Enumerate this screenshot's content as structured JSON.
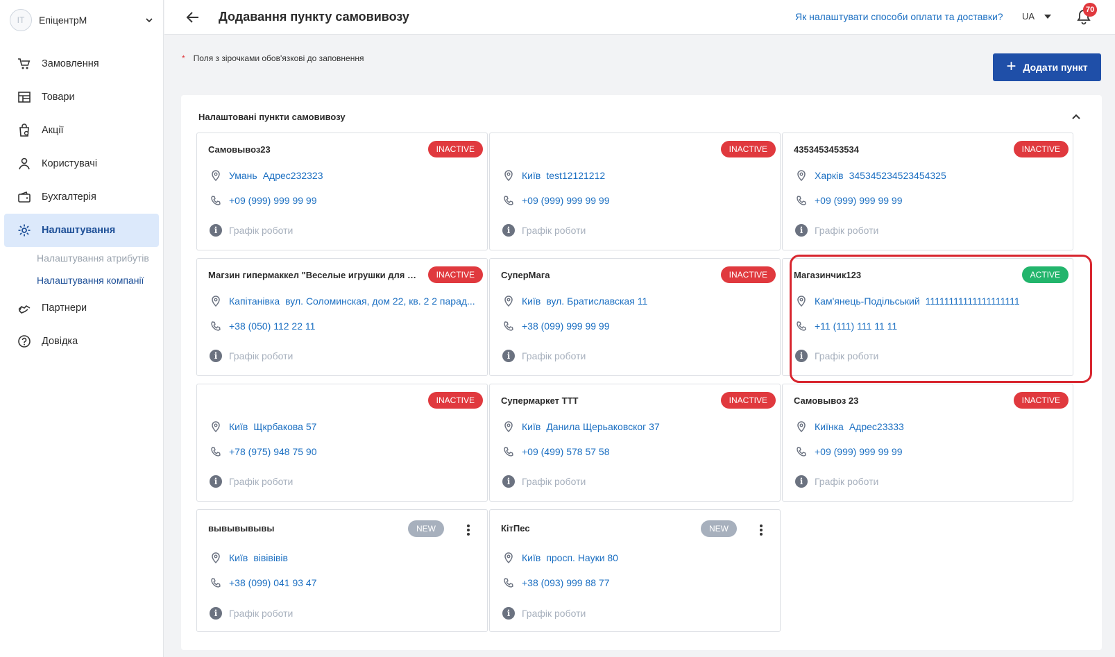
{
  "sidebar": {
    "avatar_initials": "IT",
    "company_name": "ЕпіцентрМ",
    "items": [
      {
        "label": "Замовлення",
        "icon": "cart-icon"
      },
      {
        "label": "Товари",
        "icon": "store-icon"
      },
      {
        "label": "Акції",
        "icon": "shopping-bag-icon"
      },
      {
        "label": "Користувачі",
        "icon": "user-icon"
      },
      {
        "label": "Бухгалтерія",
        "icon": "wallet-icon"
      },
      {
        "label": "Налаштування",
        "icon": "gear-icon",
        "active": true
      },
      {
        "label": "Партнери",
        "icon": "handshake-icon"
      },
      {
        "label": "Довідка",
        "icon": "question-circle-icon"
      }
    ],
    "sub_items": [
      {
        "label": "Налаштування атрибутів"
      },
      {
        "label": "Налаштування компанії",
        "active": true
      }
    ]
  },
  "header": {
    "title": "Додавання пункту самовивозу",
    "help_link": "Як налаштувати способи оплати та доставки?",
    "language": "UA",
    "notifications_count": "70"
  },
  "main": {
    "required_note": "Поля з зірочками обов'язкові до заповнення",
    "required_star": "*",
    "add_button": "Додати пункт",
    "panel_title": "Налаштовані пункти самовивозу",
    "schedule_label": "Графік роботи",
    "cards": [
      {
        "title": "Самовывоз23",
        "status": "INACTIVE",
        "city": "Умань",
        "address": "Адрес232323",
        "phone": "+09 (999) 999 99 99"
      },
      {
        "title": "",
        "status": "INACTIVE",
        "city": "Київ",
        "address": "test12121212",
        "phone": "+09 (999) 999 99 99"
      },
      {
        "title": "4353453453534",
        "status": "INACTIVE",
        "city": "Харків",
        "address": "345345234523454325",
        "phone": "+09 (999) 999 99 99"
      },
      {
        "title": "Магзин гипермаккел \"Веселые игрушки для ва...",
        "status": "INACTIVE",
        "city": "Капітанівка",
        "address": "вул. Соломинская, дом 22, кв. 2 2 парад...",
        "phone": "+38 (050) 112 22 11"
      },
      {
        "title": "СуперМага",
        "status": "INACTIVE",
        "city": "Київ",
        "address": "вул. Братиславская 11",
        "phone": "+38 (099) 999 99 99"
      },
      {
        "title": "Магазинчик123",
        "status": "ACTIVE",
        "city": "Кам'янець-Подільський",
        "address": "11111111111111111111",
        "phone": "+11 (111) 111 11 11"
      },
      {
        "title": "",
        "status": "INACTIVE",
        "city": "Київ",
        "address": "Щкрбакова 57",
        "phone": "+78 (975) 948 75 90"
      },
      {
        "title": "Супермаркет ТТТ",
        "status": "INACTIVE",
        "city": "Київ",
        "address": "Данила Щерьаковског 37",
        "phone": "+09 (499) 578 57 58"
      },
      {
        "title": "Самовывоз 23",
        "status": "INACTIVE",
        "city": "Киїнка",
        "address": "Адрес23333",
        "phone": "+09 (999) 999 99 99"
      },
      {
        "title": "вывывывывы",
        "status": "NEW",
        "city": "Київ",
        "address": "вівівівів",
        "phone": "+38 (099) 041 93 47"
      },
      {
        "title": "КітПес",
        "status": "NEW",
        "city": "Київ",
        "address": "просп. Науки 80",
        "phone": "+38 (093) 999 88 77"
      }
    ]
  },
  "colors": {
    "accent": "#1f4fa8",
    "link": "#1b6fc2",
    "inactive": "#e0393e",
    "active": "#22b56c",
    "new": "#a7b0bd",
    "highlight": "#d8262f"
  }
}
